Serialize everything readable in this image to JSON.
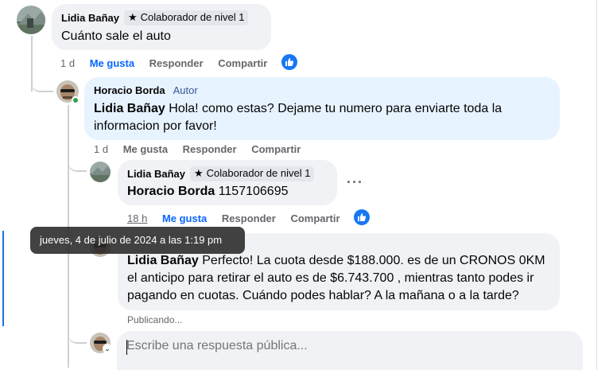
{
  "comments": [
    {
      "author": "Lidia Bañay",
      "badge": "Colaborador de nivel 1",
      "text": "Cuánto sale el auto",
      "time": "1 d",
      "like": "Me gusta",
      "reply": "Responder",
      "share": "Compartir"
    },
    {
      "author": "Horacio Borda",
      "author_tag": "Autor",
      "mention": "Lidia Bañay",
      "text_line1": " Hola! como estas? Dejame tu numero para enviarte toda la",
      "text_line2": "informacion por favor!",
      "time": "1 d",
      "like": "Me gusta",
      "reply": "Responder",
      "share": "Compartir"
    },
    {
      "author": "Lidia Bañay",
      "badge": "Colaborador de nivel 1",
      "mention": "Horacio Borda",
      "text": " 1157106695",
      "time": "18 h",
      "like": "Me gusta",
      "reply": "Responder",
      "share": "Compartir",
      "more": "···"
    },
    {
      "mention": "Lidia Bañay",
      "text_line1": " Perfecto! La cuota desde $188.000. es de un CRONOS 0KM",
      "text_line2": "el anticipo para retirar el auto es de $6.743.700 , mientras tanto podes ir",
      "text_line3": "pagando en cuotas. Cuándo podes hablar? A la mañana o a la tarde?",
      "status": "Publicando..."
    }
  ],
  "tooltip": "jueves, 4 de julio de 2024 a las 1:19 pm",
  "reply_box": {
    "placeholder": "Escribe una respuesta pública..."
  },
  "colors": {
    "accent": "#0866ff",
    "like_badge": "#1877f2",
    "bubble_grey": "#f0f2f5",
    "bubble_blue": "#e7f3ff"
  },
  "icons": [
    "star-icon",
    "like-thumb-icon",
    "more-options-icon",
    "online-dot-icon"
  ]
}
